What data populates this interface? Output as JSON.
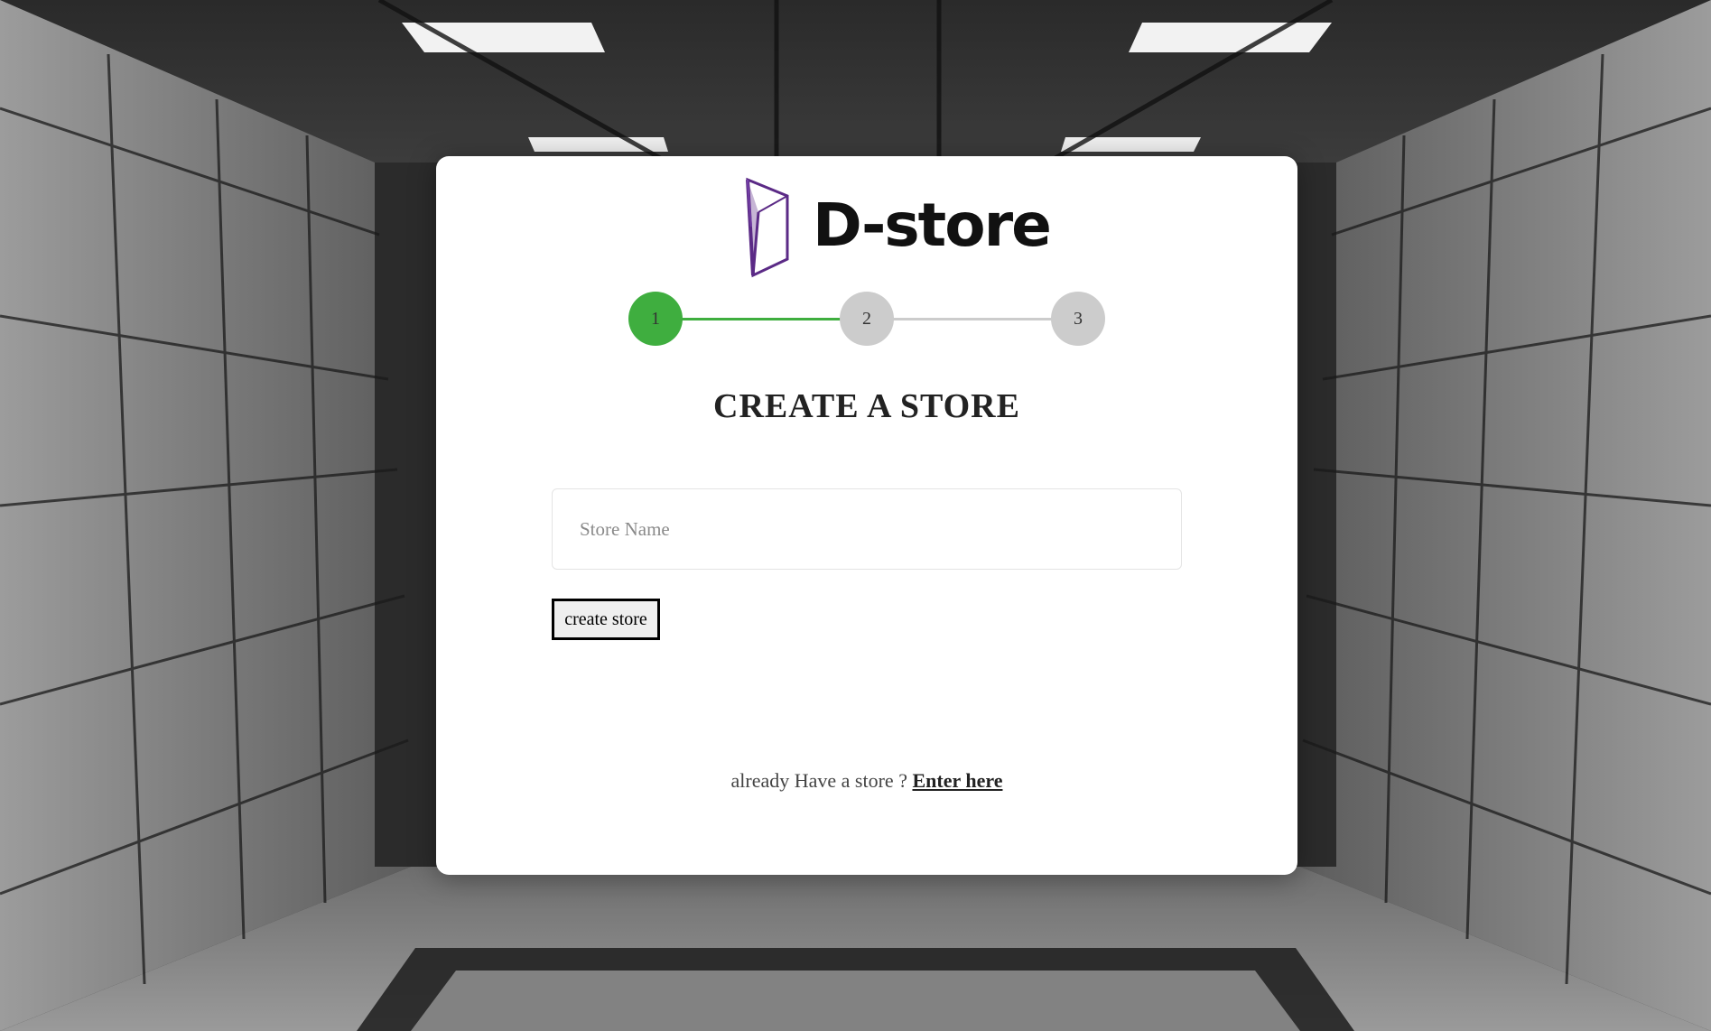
{
  "brand": {
    "name": "D-store",
    "logo_icon": "prism-logo-icon",
    "accent_color": "#5b2a86"
  },
  "stepper": {
    "steps": [
      {
        "label": "1",
        "state": "active"
      },
      {
        "label": "2",
        "state": "pending"
      },
      {
        "label": "3",
        "state": "pending"
      }
    ],
    "active_color": "#3fae3f",
    "inactive_color": "#cccccc"
  },
  "form": {
    "title": "CREATE A STORE",
    "store_name_placeholder": "Store Name",
    "store_name_value": "",
    "submit_label": "create store"
  },
  "footer": {
    "prompt_text": "already Have a store ?",
    "link_label": "Enter here"
  }
}
